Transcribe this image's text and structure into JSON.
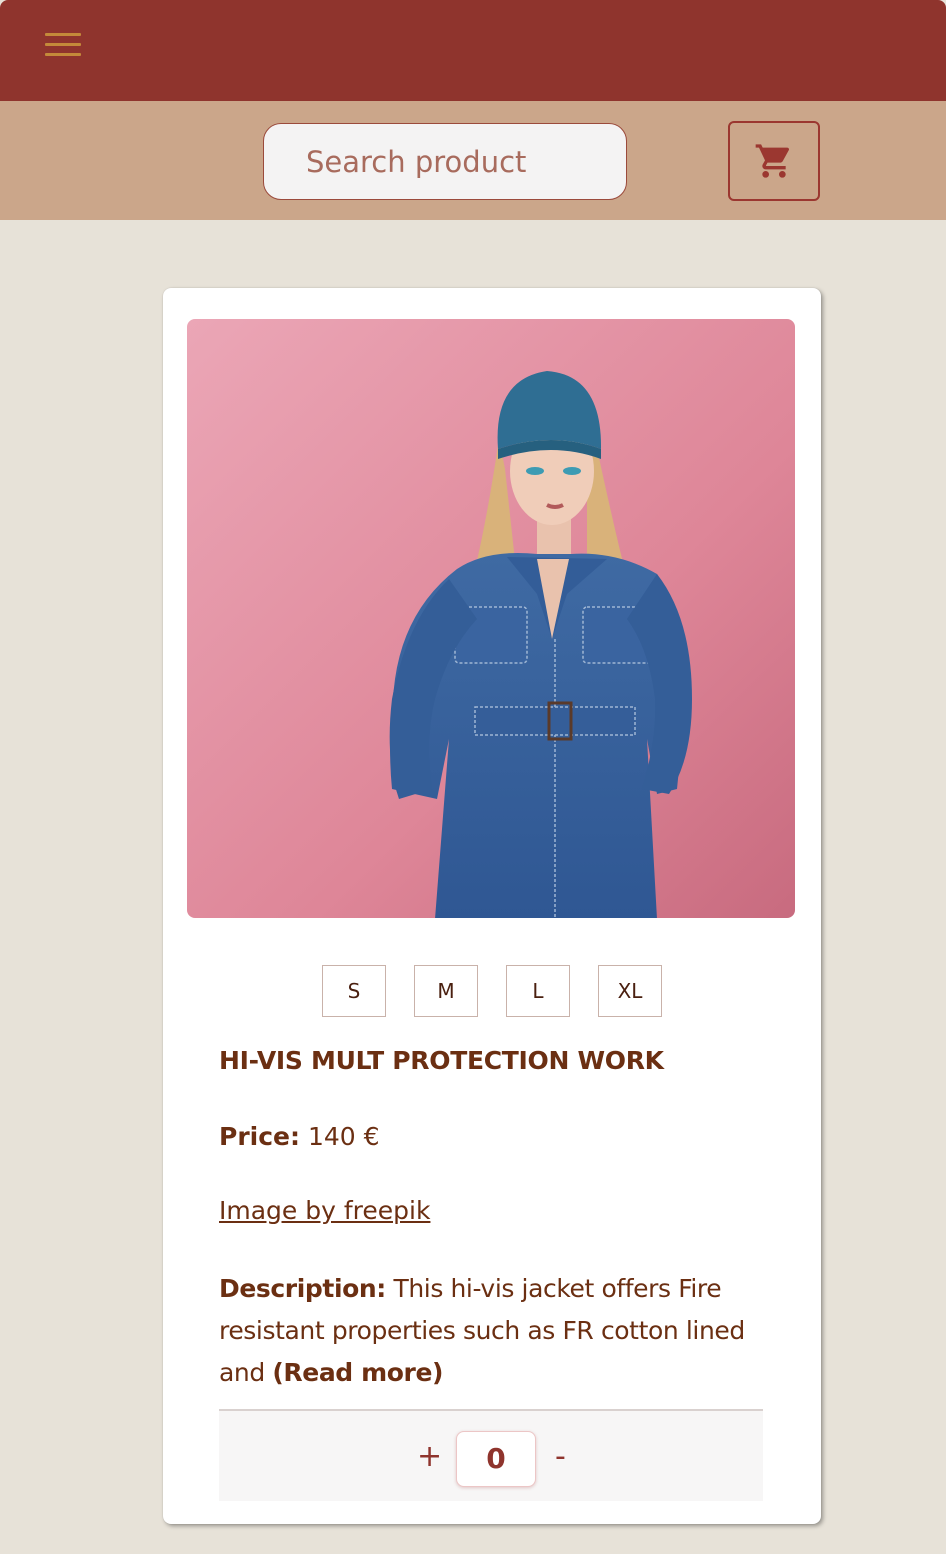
{
  "header": {
    "menu_icon": "hamburger-menu-icon",
    "accent_color": "#8f342d"
  },
  "search": {
    "placeholder": "Search product"
  },
  "cart": {
    "icon": "shopping-cart-icon"
  },
  "product": {
    "image_alt": "Woman in denim jumpsuit and blue beanie on pink background",
    "sizes": [
      "S",
      "M",
      "L",
      "XL"
    ],
    "title": "HI-VIS MULT PROTECTION WORK",
    "price_label": "Price:",
    "price_value": "140 €",
    "credit_link": "Image by freepik",
    "description_label": "Description:",
    "description_text": "This hi-vis jacket offers Fire resistant properties such as FR cotton lined and",
    "read_more": "(Read more)",
    "quantity": {
      "plus": "+",
      "value": "0",
      "minus": "-"
    }
  }
}
